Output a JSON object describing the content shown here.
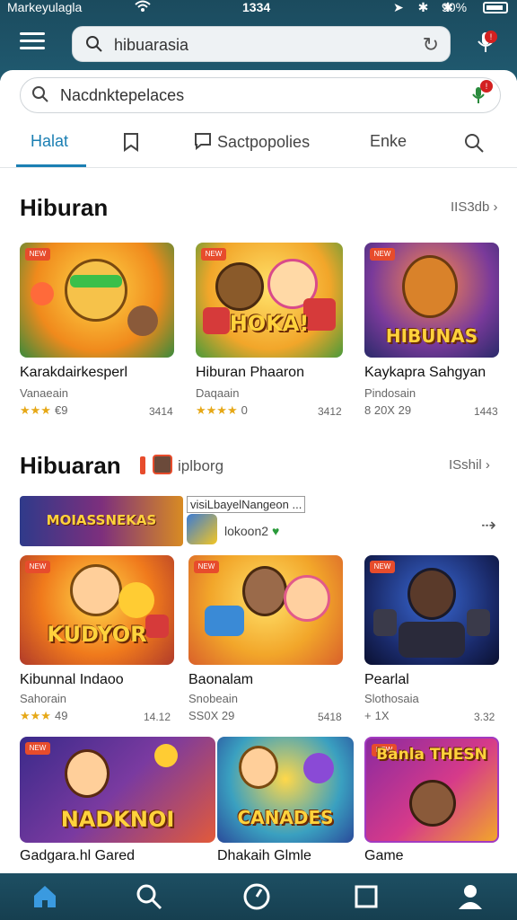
{
  "status_bar": {
    "carrier": "Markeyulagla",
    "time": "1334",
    "battery": "90%"
  },
  "top_search": {
    "query": "hibuarasia"
  },
  "search": {
    "placeholder": "Nacdnktepelaces"
  },
  "tabs": [
    {
      "label": "Halat"
    },
    {
      "label": ""
    },
    {
      "label": "Sactpopolies"
    },
    {
      "label": "Enke"
    },
    {
      "label": ""
    }
  ],
  "section1": {
    "title": "Hiburan",
    "more": "IIS3db",
    "cards": [
      {
        "title": "Karakdairkesperl",
        "subtitle": "Vanaeain",
        "rating": "€9",
        "stars": "★★★",
        "size": "3414",
        "banner": ""
      },
      {
        "title": "Hiburan Phaaron",
        "subtitle": "Daqaain",
        "rating": "0",
        "stars": "★★★★",
        "size": "3412",
        "banner": "HOKA!"
      },
      {
        "title": "Kaykapra Sahgyan",
        "subtitle": "Pindosain",
        "rating": "8 20X  29",
        "stars": "",
        "size": "1443",
        "banner": "HIBUNAS"
      }
    ]
  },
  "section2": {
    "title": "Hibuaran",
    "subtitle": "iplborg",
    "more": "ISshil",
    "promo": {
      "banner": "MOIASSNEKAS",
      "tag": "visiLbayelNangeon ...",
      "app_name": "lokoon2"
    },
    "cards": [
      {
        "title": "Kibunnal Indaoo",
        "subtitle": "Sahorain",
        "rating": "49",
        "stars": "★★★",
        "size": "14.12",
        "banner": "KUDYOR"
      },
      {
        "title": "Baonalam",
        "subtitle": "Snobeain",
        "rating": "SS0X 29",
        "stars": "",
        "size": "5418",
        "banner": ""
      },
      {
        "title": "Pearlal",
        "subtitle": "Slothosaia",
        "rating": "1X",
        "stars": "+",
        "size": "3.32",
        "banner": ""
      }
    ]
  },
  "section3": {
    "cards": [
      {
        "title": "Gadgara.hl Gared",
        "banner": "NADKNOI"
      },
      {
        "title": "Dhakaih Glmle",
        "banner": "CANADES"
      },
      {
        "title": "Game",
        "banner": "Banla THESN"
      }
    ]
  },
  "bottom_nav": [
    {
      "icon": "home-icon"
    },
    {
      "icon": "search-icon"
    },
    {
      "icon": "compass-icon"
    },
    {
      "icon": "square-icon"
    },
    {
      "icon": "profile-icon"
    }
  ]
}
